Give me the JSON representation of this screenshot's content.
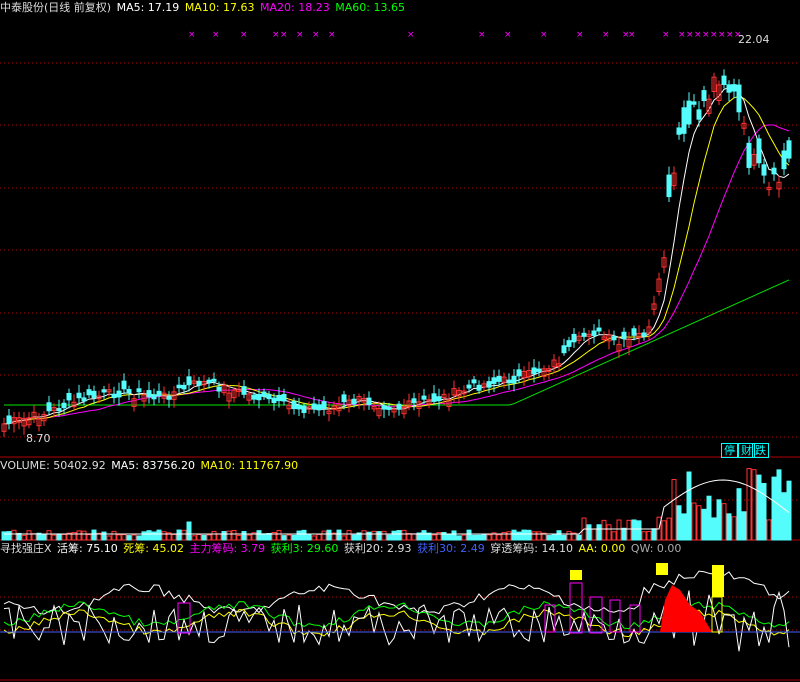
{
  "colors": {
    "up": "#ff3232",
    "down": "#54fcfc",
    "ma5": "#ffffff",
    "ma10": "#ffff00",
    "ma20": "#ff00ff",
    "ma60": "#00e600",
    "grid": "#b00000"
  },
  "header": {
    "title": "中泰股份(日线 前复权)",
    "ma5": "MA5: 17.19",
    "ma10": "MA10: 17.63",
    "ma20": "MA20: 18.23",
    "ma60": "MA60: 13.65"
  },
  "price": {
    "high_label": "22.04",
    "low_label": "8.70",
    "marker_text": "××",
    "tag_pause": "停",
    "tag_finance": "财",
    "tag_fall": "跌"
  },
  "volume": {
    "label": "VOLUME: 50402.92",
    "ma5": "MA5: 83756.20",
    "ma10": "MA10: 111767.90"
  },
  "indicator": {
    "name": "寻找强庄X",
    "active": "活筹: 75.10",
    "dead": "死筹: 45.02",
    "main": "主力筹码: 3.79",
    "profit3": "获利3: 29.60",
    "profit20": "获利20: 2.93",
    "profit30": "获利30: 2.49",
    "pierce": "穿透筹码: 14.10",
    "aa": "AA: 0.00",
    "qw": "QW: 0.00"
  }
}
